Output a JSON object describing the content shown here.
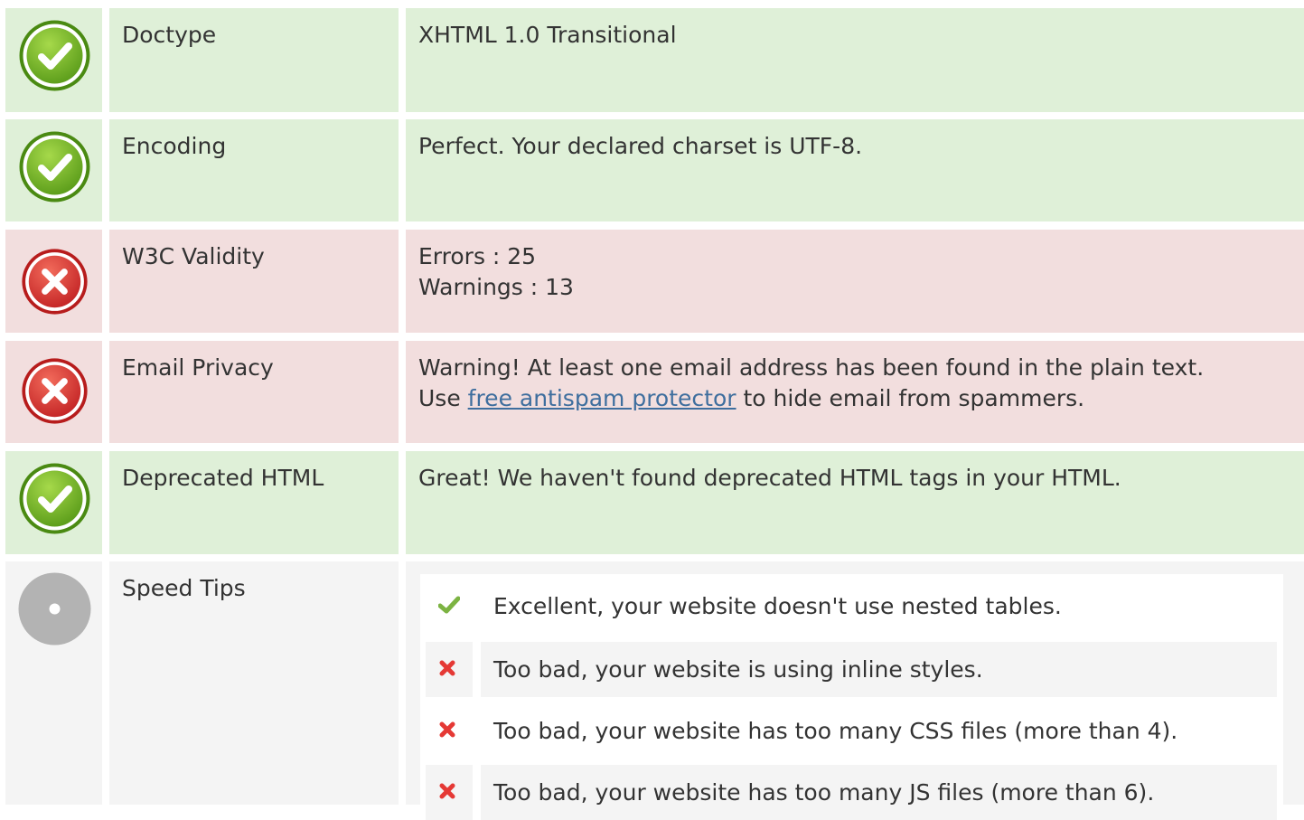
{
  "rows": [
    {
      "status": "good",
      "label": "Doctype",
      "value": "XHTML 1.0 Transitional"
    },
    {
      "status": "good",
      "label": "Encoding",
      "value": "Perfect. Your declared charset is UTF-8."
    },
    {
      "status": "bad",
      "label": "W3C Validity",
      "line1": "Errors : 25",
      "line2": "Warnings : 13"
    },
    {
      "status": "bad",
      "label": "Email Privacy",
      "line1": "Warning! At least one email address has been found in the plain text.",
      "line2_pre": "Use ",
      "link": "free antispam protector",
      "line2_post": " to hide email from spammers."
    },
    {
      "status": "good",
      "label": "Deprecated HTML",
      "value": "Great! We haven't found deprecated HTML tags in your HTML."
    },
    {
      "status": "neutral",
      "label": "Speed Tips"
    }
  ],
  "speed_tips": [
    {
      "result": "pass",
      "icon": "check-icon",
      "text": "Excellent, your website doesn't use nested tables."
    },
    {
      "result": "fail",
      "icon": "cross-icon",
      "text": "Too bad, your website is using inline styles."
    },
    {
      "result": "fail",
      "icon": "cross-icon",
      "text": "Too bad, your website has too many CSS files (more than 4)."
    },
    {
      "result": "fail",
      "icon": "cross-icon",
      "text": "Too bad, your website has too many JS files (more than 6)."
    }
  ],
  "colors": {
    "good_bg": "#dff0d8",
    "bad_bg": "#f2dede",
    "neutral_bg": "#f4f4f4",
    "link": "#3e6e9e",
    "check": "#7cb342",
    "cross": "#e53935"
  }
}
